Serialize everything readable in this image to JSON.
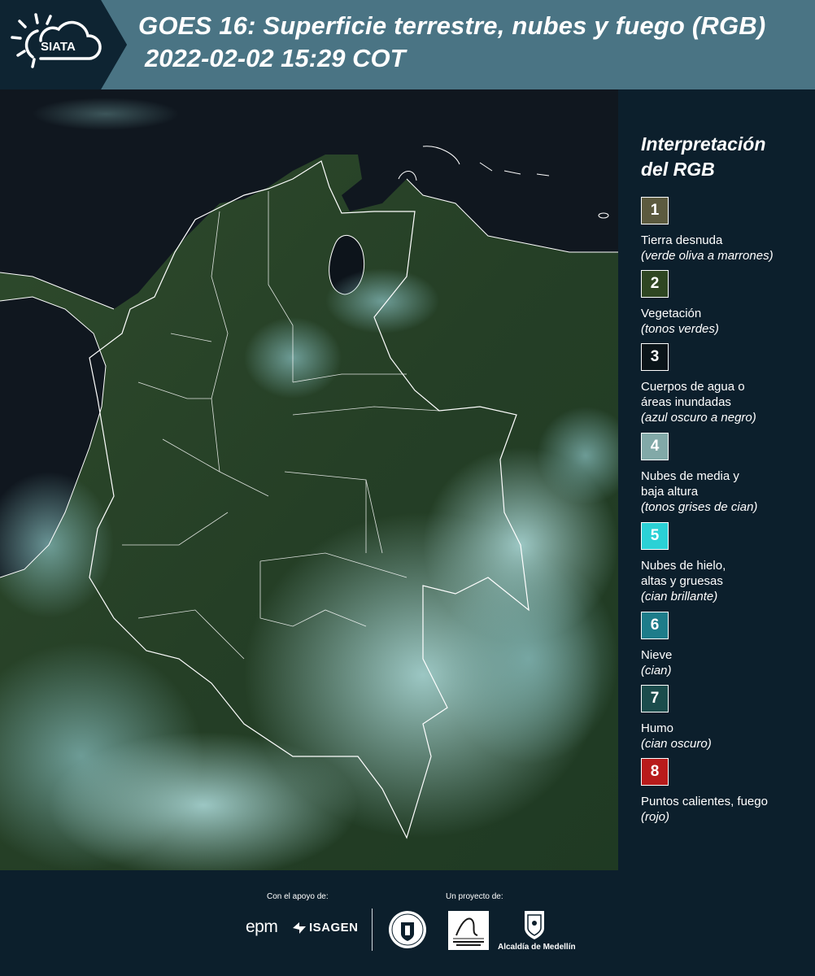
{
  "header": {
    "logo_text": "SIATA",
    "title": "GOES 16: Superficie terrestre, nubes y fuego (RGB)",
    "timestamp": "2022-02-02 15:29 COT"
  },
  "legend": {
    "title_line1": "Interpretación",
    "title_line2": "del RGB",
    "items": [
      {
        "number": "1",
        "color": "#5c5a3f",
        "label": "Tierra desnuda",
        "description": "(verde oliva a marrones)"
      },
      {
        "number": "2",
        "color": "#2f4622",
        "label": "Vegetación",
        "description": "(tonos verdes)"
      },
      {
        "number": "3",
        "color": "#0b1419",
        "label": "Cuerpos de agua o\náreas inundadas",
        "description": "(azul oscuro a negro)"
      },
      {
        "number": "4",
        "color": "#82a9a8",
        "label": "Nubes de media y\nbaja altura",
        "description": "(tonos grises de cian)"
      },
      {
        "number": "5",
        "color": "#2bd1d6",
        "label": "Nubes de hielo,\naltas y gruesas",
        "description": "(cian brillante)"
      },
      {
        "number": "6",
        "color": "#1e7c8a",
        "label": "Nieve",
        "description": "(cian)"
      },
      {
        "number": "7",
        "color": "#1b4c4c",
        "label": "Humo",
        "description": "(cian oscuro)"
      },
      {
        "number": "8",
        "color": "#b81b1b",
        "label": "Puntos calientes, fuego",
        "description": "(rojo)"
      }
    ]
  },
  "footer": {
    "support_caption": "Con el apoyo de:",
    "project_caption": "Un proyecto de:",
    "sponsor_epm": "epm",
    "sponsor_isagen": "ISAGEN",
    "alcaldia": "Alcaldía de Medellín"
  },
  "colors": {
    "background": "#0c1f2c",
    "header_band": "#4a7484",
    "header_dark": "#0e2432"
  }
}
